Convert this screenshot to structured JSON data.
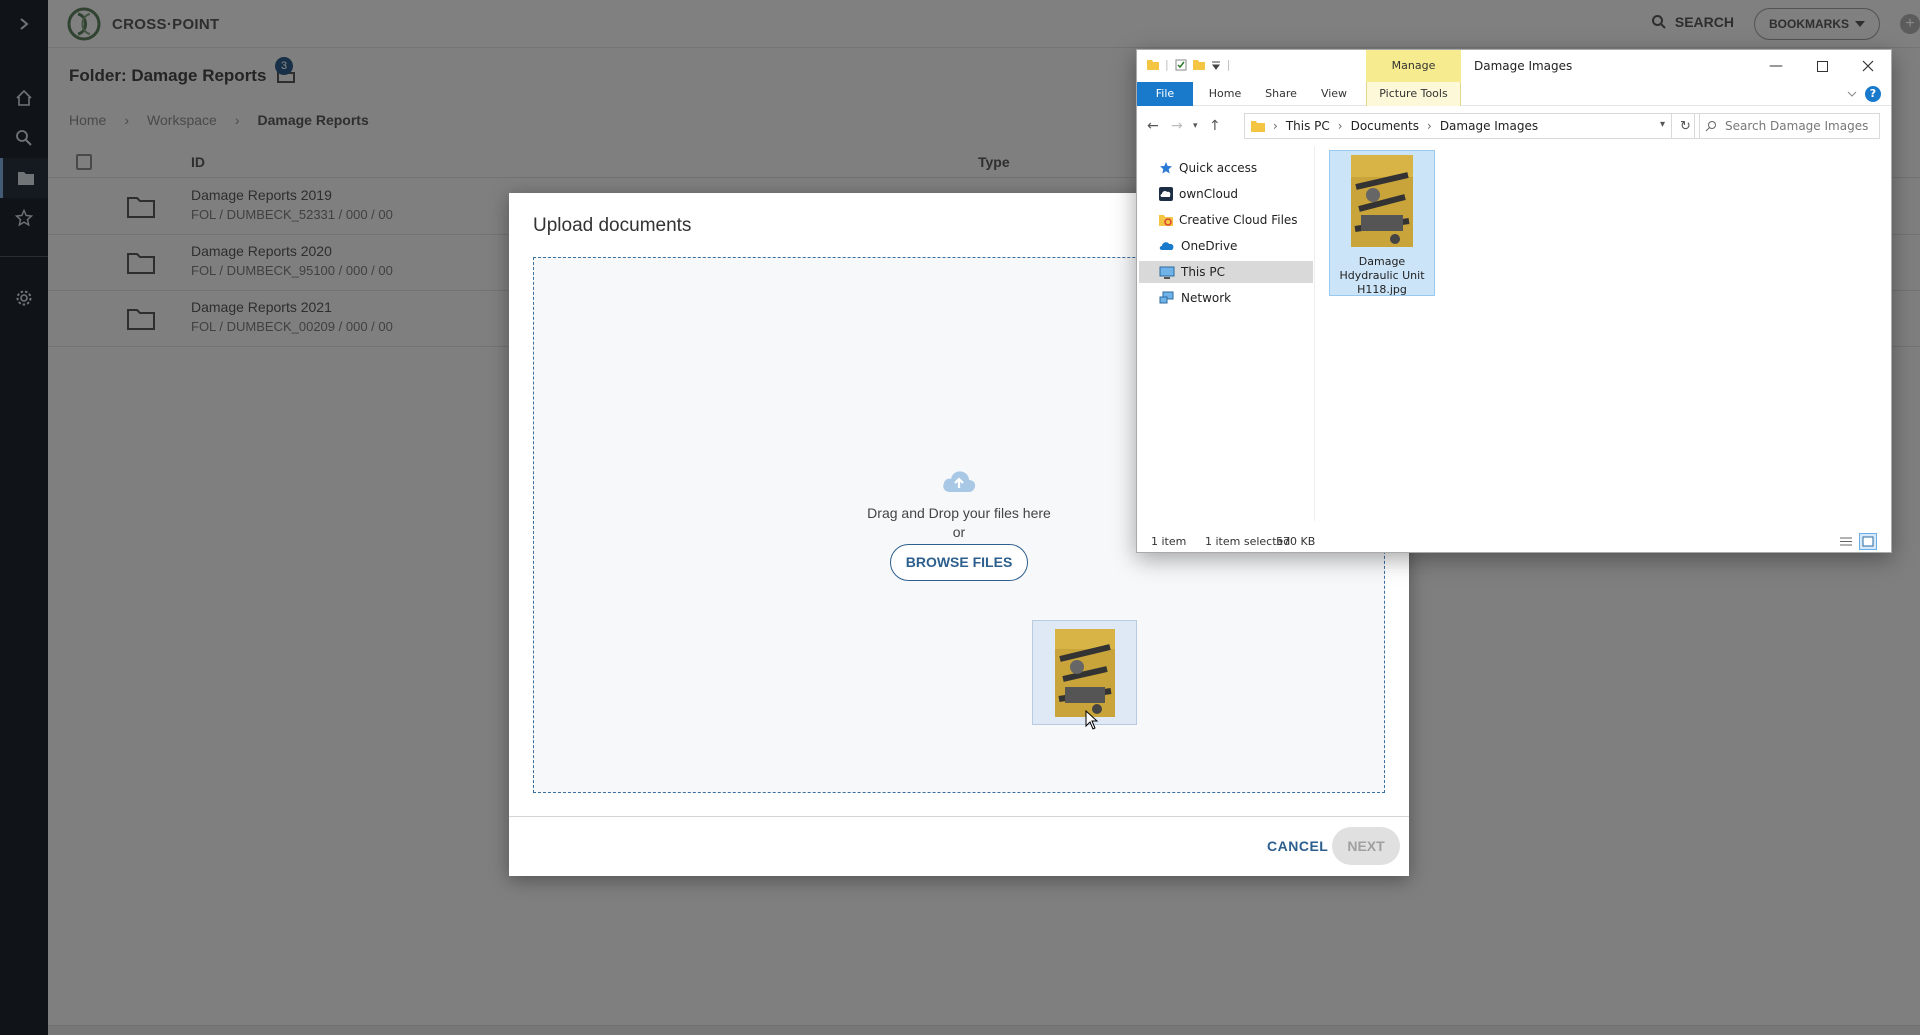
{
  "app": {
    "brand": "CROSS·POINT",
    "search_label": "SEARCH",
    "bookmarks_label": "BOOKMARKS",
    "folder_title": "Folder: Damage Reports",
    "folder_count": "3",
    "breadcrumb": [
      "Home",
      "Workspace",
      "Damage Reports"
    ],
    "columns": {
      "id": "ID",
      "type": "Type"
    },
    "rows": [
      {
        "title": "Damage Reports 2019",
        "sub": "FOL / DUMBECK_52331 / 000 / 00"
      },
      {
        "title": "Damage Reports 2020",
        "sub": "FOL / DUMBECK_95100 / 000 / 00"
      },
      {
        "title": "Damage Reports 2021",
        "sub": "FOL / DUMBECK_00209 / 000 / 00"
      }
    ],
    "rail_icons": [
      "chevron-right-icon",
      "home-icon",
      "search-icon",
      "folder-icon",
      "star-icon",
      "gear-icon"
    ]
  },
  "modal": {
    "title": "Upload documents",
    "drop_text": "Drag and Drop your files here",
    "or_text": "or",
    "browse_label": "BROWSE FILES",
    "cancel_label": "CANCEL",
    "next_label": "NEXT",
    "accent": "#2d5f8e"
  },
  "explorer": {
    "title": "Damage Images",
    "manage_tab": "Manage",
    "ribbon_tabs": [
      "File",
      "Home",
      "Share",
      "View",
      "Picture Tools"
    ],
    "address": [
      "This PC",
      "Documents",
      "Damage Images"
    ],
    "search_placeholder": "Search Damage Images",
    "nav": [
      "Quick access",
      "ownCloud",
      "Creative Cloud Files",
      "OneDrive",
      "This PC",
      "Network"
    ],
    "selected_nav": "This PC",
    "file": {
      "name_lines": [
        "Damage",
        "Hdydraulic Unit",
        "H118.jpg"
      ]
    },
    "status": {
      "count": "1 item",
      "selected": "1 item selected",
      "size": "570 KB"
    }
  }
}
